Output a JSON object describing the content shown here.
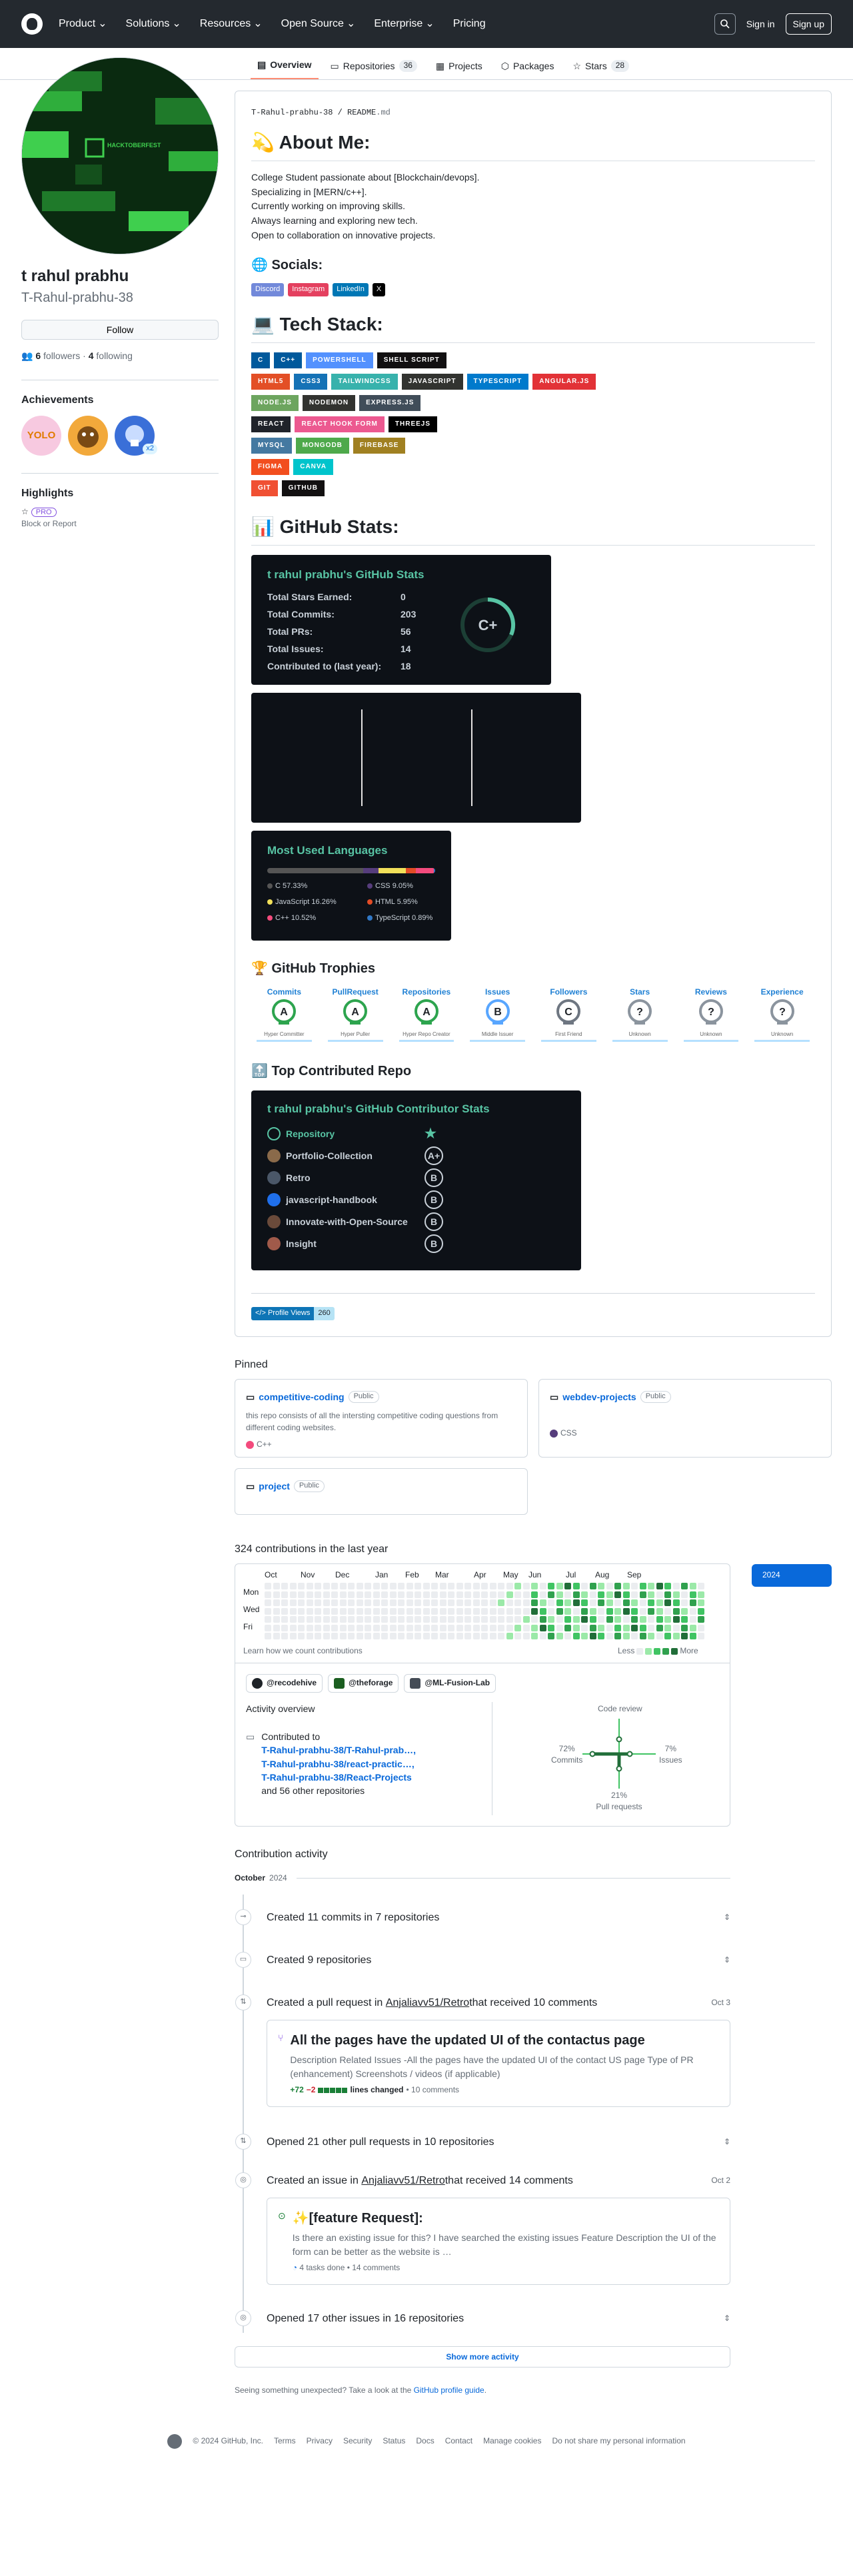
{
  "nav": {
    "items": [
      "Product",
      "Solutions",
      "Resources",
      "Open Source",
      "Enterprise",
      "Pricing"
    ],
    "sign_in": "Sign in",
    "sign_up": "Sign up"
  },
  "tabs": [
    {
      "label": "Overview"
    },
    {
      "label": "Repositories",
      "count": "36"
    },
    {
      "label": "Projects"
    },
    {
      "label": "Packages"
    },
    {
      "label": "Stars",
      "count": "28"
    }
  ],
  "profile": {
    "avatar_text": "HACKTOBERFEST",
    "name": "t rahul prabhu",
    "login": "T-Rahul-prabhu-38",
    "follow_label": "Follow",
    "followers": "6",
    "followers_label": "followers",
    "following": "4",
    "following_label": "following",
    "dot": "·"
  },
  "achievements": {
    "heading": "Achievements",
    "x2": "x2",
    "yolo": "YOLO"
  },
  "highlights": {
    "heading": "Highlights",
    "pro": "PRO",
    "block": "Block or Report"
  },
  "readme": {
    "path_user": "T-Rahul-prabhu-38",
    "path_sep": "/",
    "path_file": "README",
    "path_ext": ".md",
    "about_heading": "💫 About Me:",
    "about_lines": [
      "College Student passionate about [Blockchain/devops].",
      "Specializing in [MERN/c++].",
      "Currently working on improving skills.",
      "Always learning and exploring new tech.",
      "Open to collaboration on innovative projects."
    ],
    "socials_heading": "🌐 Socials:",
    "socials": [
      {
        "label": "Discord",
        "color": "#7289da"
      },
      {
        "label": "Instagram",
        "color": "#e4405f"
      },
      {
        "label": "LinkedIn",
        "color": "#0077b5"
      },
      {
        "label": "X",
        "color": "#000000"
      }
    ],
    "tech_heading": "💻 Tech Stack:",
    "tech_rows": [
      [
        {
          "label": "C",
          "color": "#00599c"
        },
        {
          "label": "C++",
          "color": "#00599c"
        },
        {
          "label": "POWERSHELL",
          "color": "#5391fe"
        },
        {
          "label": "SHELL SCRIPT",
          "color": "#121011"
        }
      ],
      [
        {
          "label": "HTML5",
          "color": "#e34f26"
        },
        {
          "label": "CSS3",
          "color": "#1572b6"
        },
        {
          "label": "TAILWINDCSS",
          "color": "#38b2ac"
        },
        {
          "label": "JAVASCRIPT",
          "color": "#323330"
        },
        {
          "label": "TYPESCRIPT",
          "color": "#007acc"
        },
        {
          "label": "ANGULAR.JS",
          "color": "#e23237"
        }
      ],
      [
        {
          "label": "NODE.JS",
          "color": "#6da55f"
        },
        {
          "label": "NODEMON",
          "color": "#323330"
        },
        {
          "label": "EXPRESS.JS",
          "color": "#404d59"
        }
      ],
      [
        {
          "label": "REACT",
          "color": "#20232a"
        },
        {
          "label": "REACT HOOK FORM",
          "color": "#ec5990"
        },
        {
          "label": "THREEJS",
          "color": "#000000"
        }
      ],
      [
        {
          "label": "MYSQL",
          "color": "#4479a1"
        },
        {
          "label": "MONGODB",
          "color": "#4ea94b"
        },
        {
          "label": "FIREBASE",
          "color": "#a08021"
        }
      ],
      [
        {
          "label": "FIGMA",
          "color": "#f24e1e"
        },
        {
          "label": "CANVA",
          "color": "#00c4cc"
        }
      ],
      [
        {
          "label": "GIT",
          "color": "#f05033"
        },
        {
          "label": "GITHUB",
          "color": "#121011"
        }
      ]
    ],
    "stats_heading": "📊 GitHub Stats:",
    "stats_card": {
      "title": "t rahul prabhu's GitHub Stats",
      "rows": [
        {
          "k": "Total Stars Earned:",
          "v": "0"
        },
        {
          "k": "Total Commits:",
          "v": "203"
        },
        {
          "k": "Total PRs:",
          "v": "56"
        },
        {
          "k": "Total Issues:",
          "v": "14"
        },
        {
          "k": "Contributed to (last year):",
          "v": "18"
        }
      ],
      "grade": "C+"
    },
    "langs_card": {
      "title": "Most Used Languages",
      "items": [
        {
          "name": "C",
          "pct": "57.33%",
          "value": 57.33,
          "color": "#555555"
        },
        {
          "name": "CSS",
          "pct": "9.05%",
          "value": 9.05,
          "color": "#563d7c"
        },
        {
          "name": "JavaScript",
          "pct": "16.26%",
          "value": 16.26,
          "color": "#f1e05a"
        },
        {
          "name": "HTML",
          "pct": "5.95%",
          "value": 5.95,
          "color": "#e34c26"
        },
        {
          "name": "C++",
          "pct": "10.52%",
          "value": 10.52,
          "color": "#f34b7d"
        },
        {
          "name": "TypeScript",
          "pct": "0.89%",
          "value": 0.89,
          "color": "#3178c6"
        }
      ]
    },
    "trophy_heading": "🏆 GitHub Trophies",
    "trophies": [
      {
        "t": "Commits",
        "rank": "A",
        "sub": "Hyper Committer"
      },
      {
        "t": "PullRequest",
        "rank": "A",
        "sub": "Hyper Puller"
      },
      {
        "t": "Repositories",
        "rank": "A",
        "sub": "Hyper Repo Creator"
      },
      {
        "t": "Issues",
        "rank": "B",
        "sub": "Middle Issuer"
      },
      {
        "t": "Followers",
        "rank": "C",
        "sub": "First Friend"
      },
      {
        "t": "Stars",
        "rank": "?",
        "sub": "Unknown"
      },
      {
        "t": "Reviews",
        "rank": "?",
        "sub": "Unknown"
      },
      {
        "t": "Experience",
        "rank": "?",
        "sub": "Unknown"
      }
    ],
    "top_heading": "🔝 Top Contributed Repo",
    "contrib_card": {
      "title": "t rahul prabhu's GitHub Contributor Stats",
      "header": "Repository",
      "repos": [
        {
          "name": "Portfolio-Collection",
          "grade": "A+"
        },
        {
          "name": "Retro",
          "grade": "B"
        },
        {
          "name": "javascript-handbook",
          "grade": "B"
        },
        {
          "name": "Innovate-with-Open-Source",
          "grade": "B"
        },
        {
          "name": "Insight",
          "grade": "B"
        }
      ]
    },
    "views_label": "</> Profile Views",
    "views_count": "260"
  },
  "pinned": {
    "heading": "Pinned",
    "items": [
      {
        "name": "competitive-coding",
        "badge": "Public",
        "desc": "this repo consists of all the intersting competitive coding questions from different coding websites.",
        "lang": "C++",
        "lang_color": "#f34b7d"
      },
      {
        "name": "webdev-projects",
        "badge": "Public",
        "desc": "",
        "lang": "CSS",
        "lang_color": "#563d7c"
      },
      {
        "name": "project",
        "badge": "Public",
        "desc": "",
        "lang": "",
        "lang_color": ""
      }
    ]
  },
  "contributions": {
    "heading": "324 contributions in the last year",
    "months": [
      "Oct",
      "Nov",
      "Dec",
      "Jan",
      "Feb",
      "Mar",
      "Apr",
      "May",
      "Jun",
      "Jul",
      "Aug",
      "Sep"
    ],
    "days": [
      "Mon",
      "Wed",
      "Fri"
    ],
    "learn": "Learn how we count contributions",
    "less": "Less",
    "more": "More",
    "year": "2024"
  },
  "orgs": [
    {
      "name": "@recodehive",
      "color": "#1f2328"
    },
    {
      "name": "@theforage",
      "color": "#1b5e20"
    },
    {
      "name": "@ML-Fusion-Lab",
      "color": "#444c56"
    }
  ],
  "activity": {
    "heading": "Activity overview",
    "contributed_to": "Contributed to",
    "repos": [
      "T-Rahul-prabhu-38/T-Rahul-prab…,",
      "T-Rahul-prabhu-38/react-practic…,",
      "T-Rahul-prabhu-38/React-Projects"
    ],
    "others": "and 56 other repositories",
    "radar": {
      "code_review": "Code review",
      "commits_pct": "72%",
      "commits": "Commits",
      "issues_pct": "7%",
      "issues": "Issues",
      "prs_pct": "21%",
      "prs": "Pull requests"
    }
  },
  "timeline": {
    "heading": "Contribution activity",
    "month": "October",
    "year": "2024",
    "items": {
      "commits": "Created 11 commits in 7 repositories",
      "repos": "Created 9 repositories",
      "pr": {
        "pre": "Created a pull request in ",
        "repo": "Anjaliavv51/Retro",
        "post": " that received 10 comments",
        "date": "Oct 3",
        "title": "All the pages have the updated UI of the contactus page",
        "body": "Description Related Issues -All the pages have the updated UI of the contact US page Type of PR (enhancement) Screenshots / videos (if applicable)",
        "add": "+72",
        "del": "−2",
        "lines": "lines changed",
        "comments": "• 10 comments"
      },
      "opened_prs": "Opened 21 other pull requests in 10 repositories",
      "issue": {
        "pre": "Created an issue in ",
        "repo": "Anjaliavv51/Retro",
        "post": " that received 14 comments",
        "date": "Oct 2",
        "title": "✨[feature Request]:",
        "body": "Is there an existing issue for this? I have searched the existing issues Feature Description the UI of the form can be better as the website is …",
        "tasks": "4 tasks done",
        "comments": "• 14 comments"
      },
      "opened_issues": "Opened 17 other issues in 16 repositories"
    }
  },
  "show_more": "Show more activity",
  "unexpected": {
    "pre": "Seeing something unexpected? Take a look at the ",
    "link": "GitHub profile guide",
    "post": "."
  },
  "footer": {
    "copy": "© 2024 GitHub, Inc.",
    "links": [
      "Terms",
      "Privacy",
      "Security",
      "Status",
      "Docs",
      "Contact",
      "Manage cookies",
      "Do not share my personal information"
    ]
  }
}
